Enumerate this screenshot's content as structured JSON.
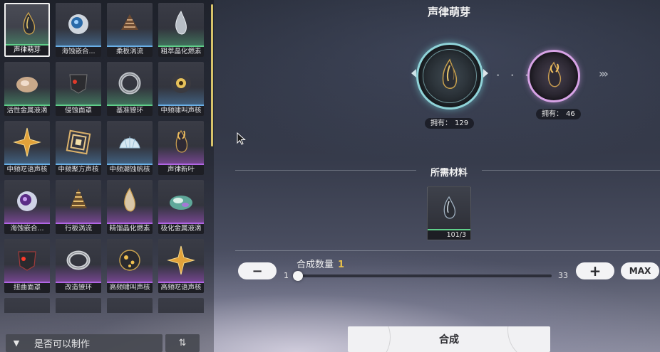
{
  "inventory": {
    "tiles": [
      {
        "label": "声律萌芽",
        "icon": "dark-crystal-icon",
        "rarity": "green",
        "selected": true
      },
      {
        "label": "海蚀嵌合...",
        "icon": "blue-orb-icon",
        "rarity": "blue"
      },
      {
        "label": "柔板涡流",
        "icon": "brown-spiral-icon",
        "rarity": "blue"
      },
      {
        "label": "粗萃晶化燃素",
        "icon": "silver-flame-icon",
        "rarity": "green"
      },
      {
        "label": "活性金属液滴",
        "icon": "metal-droplet-icon",
        "rarity": "green"
      },
      {
        "label": "侵蚀面罩",
        "icon": "dark-mask-icon",
        "rarity": "green"
      },
      {
        "label": "基准镣环",
        "icon": "metal-ring-icon",
        "rarity": "green"
      },
      {
        "label": "中频啸叫声核",
        "icon": "skull-core-icon",
        "rarity": "blue"
      },
      {
        "label": "中频呓语声核",
        "icon": "gold-star-icon",
        "rarity": "blue"
      },
      {
        "label": "中频聚方声核",
        "icon": "gold-square-spiral-icon",
        "rarity": "blue"
      },
      {
        "label": "中频潮蚀帆核",
        "icon": "white-shell-icon",
        "rarity": "blue"
      },
      {
        "label": "声律新叶",
        "icon": "purple-flame-crystal-icon",
        "rarity": "purple"
      },
      {
        "label": "海蚀嵌合...",
        "icon": "purple-orb-icon",
        "rarity": "purple"
      },
      {
        "label": "行板涡流",
        "icon": "gold-spiral-icon",
        "rarity": "purple"
      },
      {
        "label": "精馏晶化燃素",
        "icon": "gold-flame-icon",
        "rarity": "purple"
      },
      {
        "label": "极化金属液滴",
        "icon": "iridescent-droplet-icon",
        "rarity": "purple"
      },
      {
        "label": "扭曲面罩",
        "icon": "red-mask-icon",
        "rarity": "purple"
      },
      {
        "label": "改造镣环",
        "icon": "silver-ring-icon",
        "rarity": "purple"
      },
      {
        "label": "高频啸叫声核",
        "icon": "dark-gold-orb-icon",
        "rarity": "purple"
      },
      {
        "label": "高频呓语声核",
        "icon": "gold-star-icon",
        "rarity": "purple"
      }
    ],
    "filter_label": "是否可以制作",
    "filter_chevron": "▼",
    "sort_icon": "⇅"
  },
  "synthesis": {
    "title": "声律萌芽",
    "current": {
      "owned_label": "拥有：",
      "owned_count": "129",
      "icon": "dark-crystal-icon"
    },
    "next": {
      "owned_label": "拥有：",
      "owned_count": "46",
      "icon": "purple-flame-crystal-icon"
    },
    "arrows": "›››",
    "materials_title": "所需材料",
    "material": {
      "icon": "dark-crystal-icon",
      "count": "101/3"
    },
    "quantity_label": "合成数量",
    "quantity_value": "1",
    "slider_min": "1",
    "slider_max": "33",
    "slider_fraction": 0,
    "minus_label": "−",
    "plus_label": "+",
    "max_label": "MAX",
    "craft_label": "合成"
  }
}
